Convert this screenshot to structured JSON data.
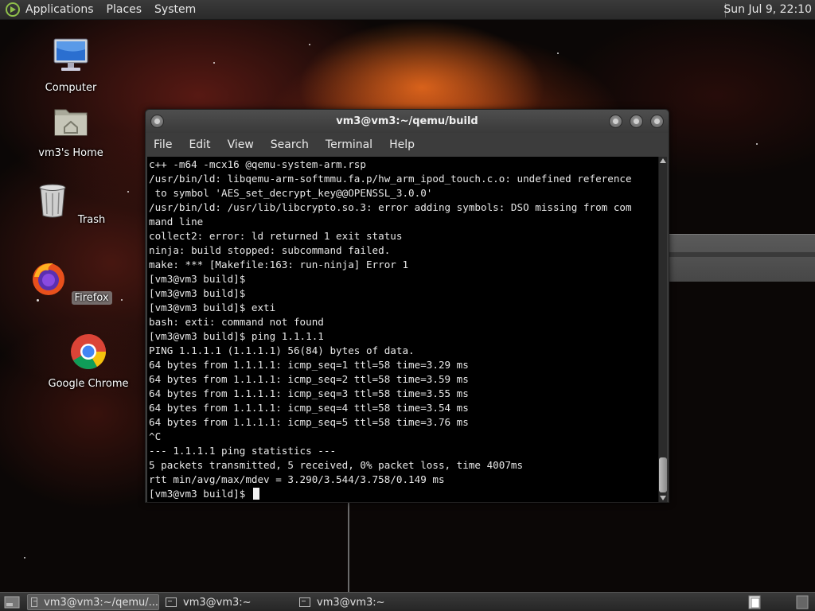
{
  "top_panel": {
    "menus": [
      "Applications",
      "Places",
      "System"
    ],
    "clock": "Sun Jul  9, 22:10"
  },
  "desktop_icons": [
    {
      "label": "Computer",
      "icon": "computer-icon"
    },
    {
      "label": "vm3's Home",
      "icon": "home-folder-icon"
    },
    {
      "label": "Trash",
      "icon": "trash-icon"
    },
    {
      "label": "Firefox",
      "icon": "firefox-icon",
      "selected": true
    },
    {
      "label": "Google Chrome",
      "icon": "chrome-icon"
    }
  ],
  "terminal": {
    "title": "vm3@vm3:~/qemu/build",
    "menu": [
      "File",
      "Edit",
      "View",
      "Search",
      "Terminal",
      "Help"
    ],
    "lines": [
      "c++ -m64 -mcx16 @qemu-system-arm.rsp",
      "/usr/bin/ld: libqemu-arm-softmmu.fa.p/hw_arm_ipod_touch.c.o: undefined reference",
      " to symbol 'AES_set_decrypt_key@@OPENSSL_3.0.0'",
      "/usr/bin/ld: /usr/lib/libcrypto.so.3: error adding symbols: DSO missing from com",
      "mand line",
      "collect2: error: ld returned 1 exit status",
      "ninja: build stopped: subcommand failed.",
      "make: *** [Makefile:163: run-ninja] Error 1",
      "[vm3@vm3 build]$",
      "[vm3@vm3 build]$",
      "[vm3@vm3 build]$ exti",
      "bash: exti: command not found",
      "[vm3@vm3 build]$ ping 1.1.1.1",
      "PING 1.1.1.1 (1.1.1.1) 56(84) bytes of data.",
      "64 bytes from 1.1.1.1: icmp_seq=1 ttl=58 time=3.29 ms",
      "64 bytes from 1.1.1.1: icmp_seq=2 ttl=58 time=3.59 ms",
      "64 bytes from 1.1.1.1: icmp_seq=3 ttl=58 time=3.55 ms",
      "64 bytes from 1.1.1.1: icmp_seq=4 ttl=58 time=3.54 ms",
      "64 bytes from 1.1.1.1: icmp_seq=5 ttl=58 time=3.76 ms",
      "^C",
      "--- 1.1.1.1 ping statistics ---",
      "5 packets transmitted, 5 received, 0% packet loss, time 4007ms",
      "rtt min/avg/max/mdev = 3.290/3.544/3.758/0.149 ms"
    ],
    "prompt": "[vm3@vm3 build]$ "
  },
  "taskbar": {
    "tasks": [
      {
        "label": "vm3@vm3:~/qemu/...",
        "active": true
      },
      {
        "label": "vm3@vm3:~",
        "active": false
      },
      {
        "label": "vm3@vm3:~",
        "active": false
      }
    ]
  },
  "colors": {
    "panel": "#2e2e2e",
    "terminal_bg": "#000000",
    "terminal_fg": "#e8e8e8"
  }
}
